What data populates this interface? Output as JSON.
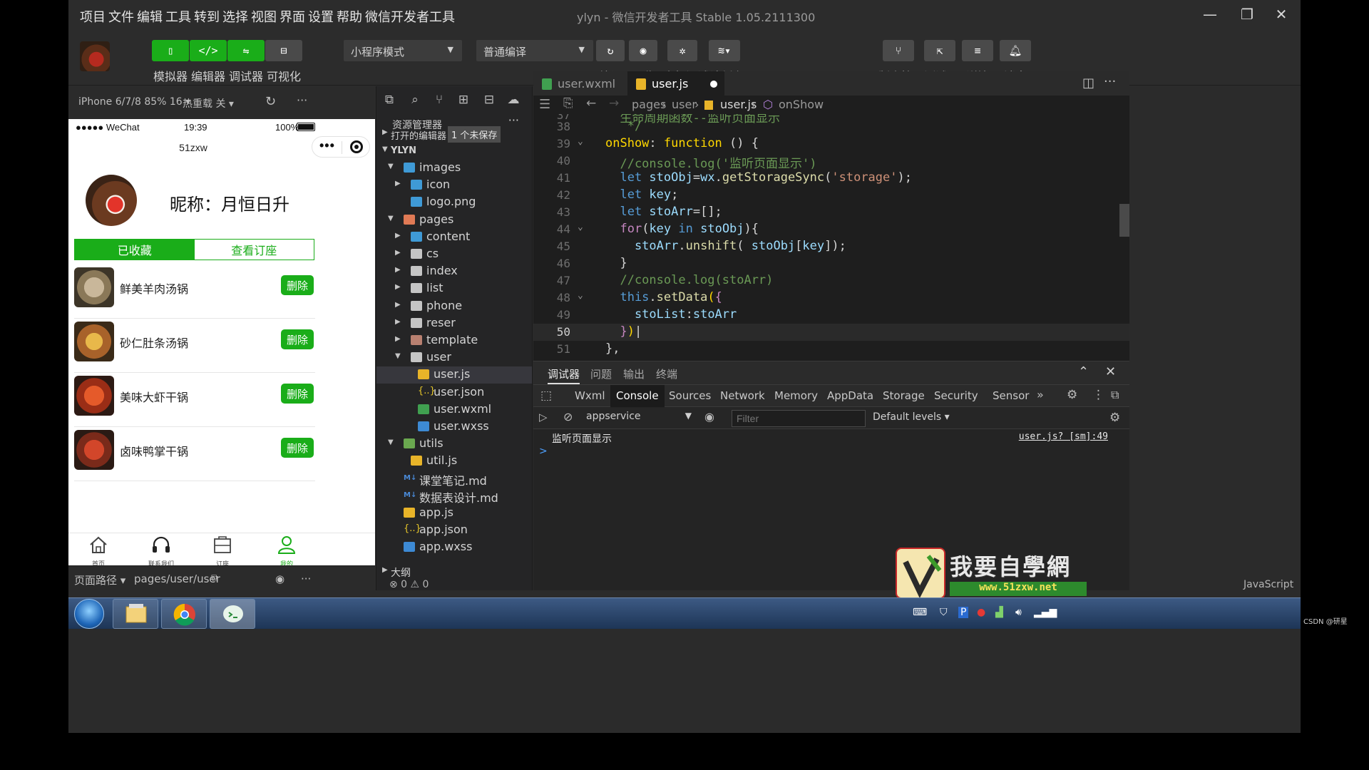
{
  "menubar": {
    "items": [
      "项目",
      "文件",
      "编辑",
      "工具",
      "转到",
      "选择",
      "视图",
      "界面",
      "设置",
      "帮助",
      "微信开发者工具"
    ],
    "title": "ylyn - 微信开发者工具 Stable 1.05.2111300"
  },
  "toolbar": {
    "left_buttons": [
      {
        "label": "模拟器",
        "icon": "phone-icon"
      },
      {
        "label": "编辑器",
        "icon": "code-icon"
      },
      {
        "label": "调试器",
        "icon": "debug-icon"
      },
      {
        "label": "可视化",
        "icon": "layout-icon"
      }
    ],
    "mode_select": "小程序模式",
    "compile_select": "普通编译",
    "mid_buttons": [
      {
        "label": "编译",
        "icon": "refresh-icon"
      },
      {
        "label": "预览",
        "icon": "eye-icon"
      },
      {
        "label": "真机调试",
        "icon": "bug-icon"
      },
      {
        "label": "清缓存",
        "icon": "layers-icon"
      }
    ],
    "right_buttons": [
      {
        "label": "版本管理",
        "icon": "branch-icon"
      },
      {
        "label": "测试号",
        "icon": "external-icon"
      },
      {
        "label": "详情",
        "icon": "menu-icon"
      },
      {
        "label": "消息",
        "icon": "bell-icon"
      }
    ]
  },
  "simulator": {
    "device": "iPhone 6/7/8 85% 16 ▾",
    "hot_reload": "热重载 关 ▾",
    "status_left": "●●●●● WeChat",
    "status_time": "19:39",
    "status_battery": "100%",
    "nav_title": "51zxw",
    "nickname": "昵称：月恒日升",
    "tabs": [
      "已收藏",
      "查看订座"
    ],
    "favorites": [
      {
        "name": "鲜美羊肉汤锅",
        "action": "删除"
      },
      {
        "name": "砂仁肚条汤锅",
        "action": "删除"
      },
      {
        "name": "美味大虾干锅",
        "action": "删除"
      },
      {
        "name": "卤味鸭掌干锅",
        "action": "删除"
      }
    ],
    "tabbar": [
      {
        "label": "首页",
        "icon": "home-icon"
      },
      {
        "label": "联系我们",
        "icon": "headset-icon"
      },
      {
        "label": "订座",
        "icon": "bag-icon"
      },
      {
        "label": "我的",
        "icon": "user-icon"
      }
    ],
    "footer_path_label": "页面路径 ▾",
    "footer_path": "pages/user/user"
  },
  "explorer": {
    "title": "资源管理器",
    "open_editors": "打开的编辑器",
    "unsaved_badge": "1 个未保存",
    "root": "YLYN",
    "tree": [
      {
        "name": "images",
        "depth": 1,
        "type": "folder-img",
        "twisty": "▼"
      },
      {
        "name": "icon",
        "depth": 2,
        "type": "folder-img",
        "twisty": "▶"
      },
      {
        "name": "logo.png",
        "depth": 2,
        "type": "png",
        "twisty": ""
      },
      {
        "name": "pages",
        "depth": 1,
        "type": "folder-pages",
        "twisty": "▼"
      },
      {
        "name": "content",
        "depth": 2,
        "type": "folder-img",
        "twisty": "▶"
      },
      {
        "name": "cs",
        "depth": 2,
        "type": "folder",
        "twisty": "▶"
      },
      {
        "name": "index",
        "depth": 2,
        "type": "folder",
        "twisty": "▶"
      },
      {
        "name": "list",
        "depth": 2,
        "type": "folder",
        "twisty": "▶"
      },
      {
        "name": "phone",
        "depth": 2,
        "type": "folder",
        "twisty": "▶"
      },
      {
        "name": "reser",
        "depth": 2,
        "type": "folder",
        "twisty": "▶"
      },
      {
        "name": "template",
        "depth": 2,
        "type": "folder-tpl",
        "twisty": "▶"
      },
      {
        "name": "user",
        "depth": 2,
        "type": "folder",
        "twisty": "▼"
      },
      {
        "name": "user.js",
        "depth": 3,
        "type": "js",
        "twisty": "",
        "selected": true
      },
      {
        "name": "user.json",
        "depth": 3,
        "type": "json",
        "twisty": ""
      },
      {
        "name": "user.wxml",
        "depth": 3,
        "type": "wxml",
        "twisty": ""
      },
      {
        "name": "user.wxss",
        "depth": 3,
        "type": "wxss",
        "twisty": ""
      },
      {
        "name": "utils",
        "depth": 1,
        "type": "folder-green",
        "twisty": "▼"
      },
      {
        "name": "util.js",
        "depth": 2,
        "type": "js",
        "twisty": ""
      },
      {
        "name": "课堂笔记.md",
        "depth": 1,
        "type": "md",
        "twisty": ""
      },
      {
        "name": "数据表设计.md",
        "depth": 1,
        "type": "md",
        "twisty": ""
      },
      {
        "name": "app.js",
        "depth": 1,
        "type": "js",
        "twisty": ""
      },
      {
        "name": "app.json",
        "depth": 1,
        "type": "json",
        "twisty": ""
      },
      {
        "name": "app.wxss",
        "depth": 1,
        "type": "wxss",
        "twisty": ""
      }
    ],
    "outline": "大纲",
    "problems_count": "⊗ 0 ⚠ 0"
  },
  "editor": {
    "tabs": [
      {
        "name": "user.wxml",
        "active": false
      },
      {
        "name": "user.js",
        "active": true,
        "modified": true
      }
    ],
    "breadcrumb": [
      "pages",
      "user",
      "user.js",
      "onShow"
    ],
    "current_line": 50
  },
  "devtools": {
    "top_tabs": [
      "调试器",
      "问题",
      "输出",
      "终端"
    ],
    "panel_tabs": [
      "Wxml",
      "Console",
      "Sources",
      "Network",
      "Memory",
      "AppData",
      "Storage",
      "Security",
      "Sensor"
    ],
    "active_panel": "Console",
    "context": "appservice",
    "filter_placeholder": "Filter",
    "levels": "Default levels ▾",
    "log_message": "监听页面显示",
    "log_source": "user.js? [sm]:49",
    "prompt": ">"
  },
  "status_bar": {
    "language": "JavaScript"
  },
  "watermark": {
    "cn": "我要自學網",
    "url": "www.51zxw.net"
  },
  "taskbar": {
    "credit": "CSDN @研星"
  }
}
